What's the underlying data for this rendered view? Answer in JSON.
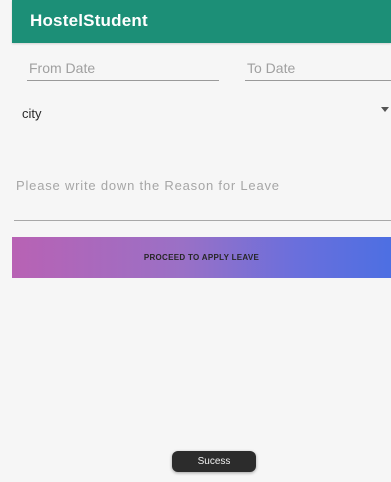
{
  "app_bar": {
    "title": "HostelStudent",
    "color": "#1c8f77"
  },
  "form": {
    "from_date_placeholder": "From Date",
    "to_date_placeholder": "To Date",
    "city_selected": "city",
    "reason_value": "",
    "reason_placeholder": "Please write down the Reason for Leave"
  },
  "button": {
    "apply_label": "PROCEED TO APPLY LEAVE"
  },
  "toast": {
    "message": "Sucess"
  }
}
